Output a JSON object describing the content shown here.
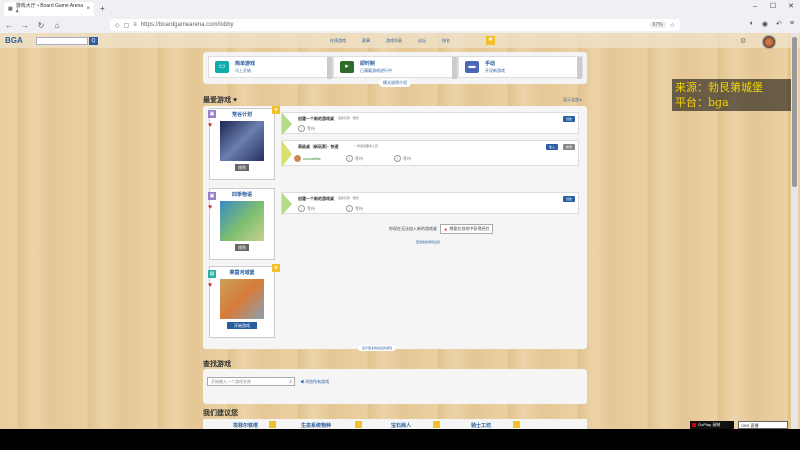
{
  "browser": {
    "tab_title": "游戏大厅 • Board Game Arena 4",
    "tab_close": "×",
    "new_tab": "+",
    "url": "https://boardgamearena.com/lobby",
    "zoom": "67%",
    "win_min": "–",
    "win_max": "☐",
    "win_close": "✕"
  },
  "bga": {
    "logo": "BGA",
    "search_btn": "Q",
    "menu": [
      "在线游戏",
      "赛事",
      "游戏列表",
      "论坛",
      "排名"
    ]
  },
  "watermark": {
    "line1": "来源：勃艮第城堡",
    "line2": "平台：bga"
  },
  "modes": [
    {
      "title": "简单游戏",
      "sub": "马上开始",
      "icon": "▭"
    },
    {
      "title": "即时制",
      "sub": "已满载游戏进行中",
      "icon": "▸"
    },
    {
      "title": "手动",
      "sub": "开设新游戏",
      "icon": "▬"
    }
  ],
  "learn_more": "模式说明介绍",
  "favorites": {
    "title": "最爱游戏",
    "heart": "♥",
    "link": "显示全部 ▸",
    "games": [
      {
        "name": "荒谷计划",
        "rules": "规则",
        "tables": [
          {
            "title": "创建一个新的游戏桌",
            "meta": "最新玩家 · 规则",
            "button": "创建",
            "seat": "等待"
          },
          {
            "title": "高级桌（新玩家）· 快速",
            "meta": "一局游戏要求上有",
            "button": "加入",
            "button2": "参观",
            "seat_player": "cocoalittle",
            "seat1": "等待",
            "seat2": "等待"
          }
        ]
      },
      {
        "name": "四季物语",
        "rules": "规则",
        "tables": [
          {
            "title": "创建一个新的游戏桌",
            "meta": "最新玩家 · 规则",
            "button": "创建",
            "seat1": "等待",
            "seat2": "等待"
          }
        ],
        "hint": "你现在无法加入新的游戏桌",
        "hint_btn": "想要在游戏中获得经验",
        "settings_link": "更改我的游戏设置"
      },
      {
        "name": "莱茵河城堡",
        "start": "开始游戏"
      }
    ],
    "more": "显示更多我最爱的游戏"
  },
  "find": {
    "title": "查找游戏",
    "placeholder": "开始输入一个游戏名称",
    "link": "◀ 浏览所有游戏"
  },
  "suggestions": {
    "title": "我们建议您",
    "items": [
      "埃菲尔铁塔",
      "生态系统物种",
      "宝石商人",
      "骑士工坊"
    ]
  },
  "taskbar": {
    "item1": "GoPlay 录制",
    "item2": "OBS 直播"
  },
  "colors": {
    "accent": "#2a5ea0",
    "star": "#f2c02c",
    "flag": "#b9d98a"
  }
}
